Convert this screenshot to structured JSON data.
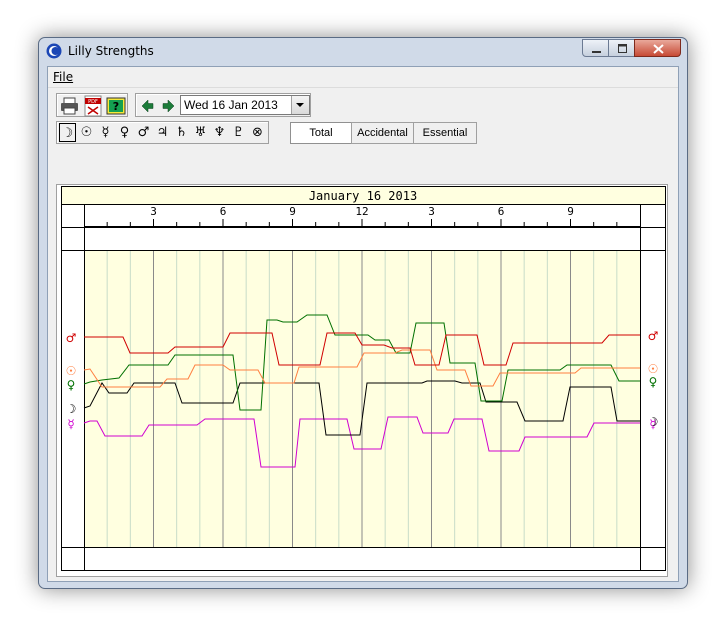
{
  "window": {
    "title": "Lilly Strengths"
  },
  "menu": {
    "file": "File"
  },
  "toolbar": {
    "print_icon": "printer-icon",
    "pdf_icon": "pdf-export-icon",
    "help_icon": "help-icon",
    "date_value": "Wed 16 Jan 2013"
  },
  "planets": [
    {
      "glyph": "☽",
      "name": "Moon"
    },
    {
      "glyph": "☉",
      "name": "Sun"
    },
    {
      "glyph": "☿",
      "name": "Mercury"
    },
    {
      "glyph": "♀",
      "name": "Venus"
    },
    {
      "glyph": "♂",
      "name": "Mars"
    },
    {
      "glyph": "♃",
      "name": "Jupiter"
    },
    {
      "glyph": "♄",
      "name": "Saturn"
    },
    {
      "glyph": "♅",
      "name": "Uranus"
    },
    {
      "glyph": "♆",
      "name": "Neptune"
    },
    {
      "glyph": "♇",
      "name": "Pluto"
    },
    {
      "glyph": "⊗",
      "name": "Part of Fortune"
    }
  ],
  "tabs": {
    "total": "Total",
    "accidental": "Accidental",
    "essential": "Essential"
  },
  "chart": {
    "title": "January 16 2013",
    "hour_labels": [
      "3",
      "6",
      "9",
      "12",
      "3",
      "6",
      "9"
    ],
    "colors": {
      "mars": "#d00000",
      "sun": "#ff7f40",
      "venus": "#007000",
      "moon": "#000000",
      "mercury": "#d000d0",
      "background": "#ffffe0",
      "gridline": "#c8dcc8"
    },
    "series_glyphs": {
      "mars": "♂",
      "sun": "☉",
      "venus": "♀",
      "moon": "☽",
      "mercury": "☿"
    }
  }
}
